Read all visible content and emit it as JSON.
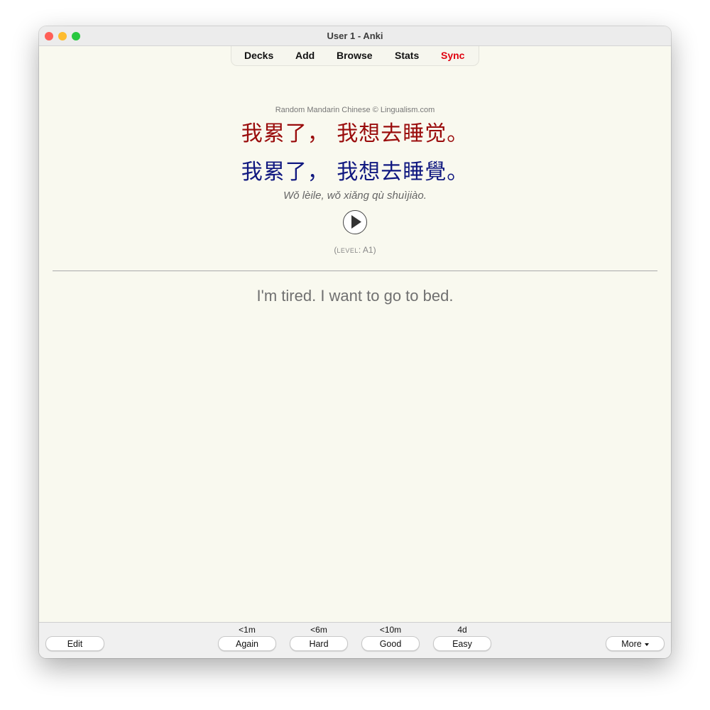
{
  "window": {
    "title": "User 1 - Anki",
    "traffic_colors": {
      "close": "#ff5f57",
      "minimize": "#febc2e",
      "zoom": "#28c840"
    }
  },
  "toolbar": {
    "decks": "Decks",
    "add": "Add",
    "browse": "Browse",
    "stats": "Stats",
    "sync": "Sync",
    "sync_color": "#e0000f"
  },
  "card": {
    "copyright": "Random Mandarin Chinese © Lingualism.com",
    "simplified": "我累了， 我想去睡觉。",
    "simplified_color": "#9a0c0c",
    "traditional": "我累了， 我想去睡覺。",
    "traditional_color": "#101880",
    "pinyin": "Wǒ lèile, wǒ xiǎng qù shuìjiào.",
    "level_open": "(",
    "level_label": "LEVEL",
    "level_sep": ": ",
    "level_value": "A1",
    "level_close": ")",
    "answer": "I'm tired. I want to go to bed."
  },
  "bottombar": {
    "edit": "Edit",
    "more": "More",
    "answers": [
      {
        "interval": "<1m",
        "label": "Again"
      },
      {
        "interval": "<6m",
        "label": "Hard"
      },
      {
        "interval": "<10m",
        "label": "Good"
      },
      {
        "interval": "4d",
        "label": "Easy"
      }
    ]
  }
}
